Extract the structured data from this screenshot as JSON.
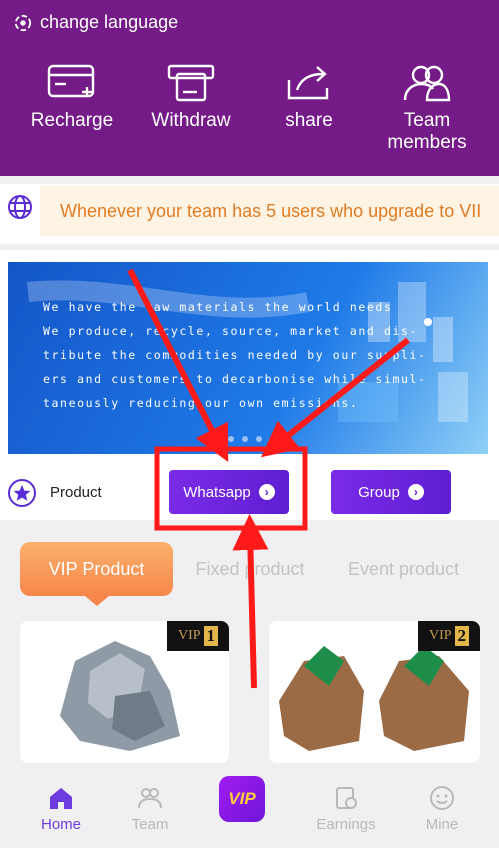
{
  "header": {
    "change_language": "change language",
    "actions": [
      {
        "label": "Recharge",
        "icon": "card-icon"
      },
      {
        "label": "Withdraw",
        "icon": "atm-withdraw-icon"
      },
      {
        "label": "share",
        "icon": "share-icon"
      },
      {
        "label": "Team\nmembers",
        "icon": "team-icon"
      }
    ],
    "bg_color": "#741b87"
  },
  "notice": {
    "text": "Whenever your team has 5 users who upgrade to VII",
    "text_color": "#e27b23"
  },
  "banner": {
    "lines": [
      "We have the raw materials the world needs",
      "We produce, recycle, source, market and dis-",
      "tribute the commodities needed by our suppli-",
      "ers and customers to decarbonise while simul-",
      "taneously reducing our own emissions."
    ]
  },
  "shortcuts": {
    "product_label": "Product",
    "whatsapp_label": "Whatsapp",
    "group_label": "Group"
  },
  "tabs": [
    {
      "label": "VIP Product",
      "active": true
    },
    {
      "label": "Fixed product",
      "active": false
    },
    {
      "label": "Event product",
      "active": false
    }
  ],
  "cards": [
    {
      "vip_text": "VIP",
      "vip_level": "1"
    },
    {
      "vip_text": "VIP",
      "vip_level": "2"
    }
  ],
  "bottom_nav": {
    "home": "Home",
    "team": "Team",
    "vip": "VIP",
    "earnings": "Earnings",
    "mine": "Mine"
  },
  "accent_colors": {
    "purple_button": "#6a22dc",
    "active_tab": "#f6874a",
    "annotation_red": "#ff0000"
  }
}
